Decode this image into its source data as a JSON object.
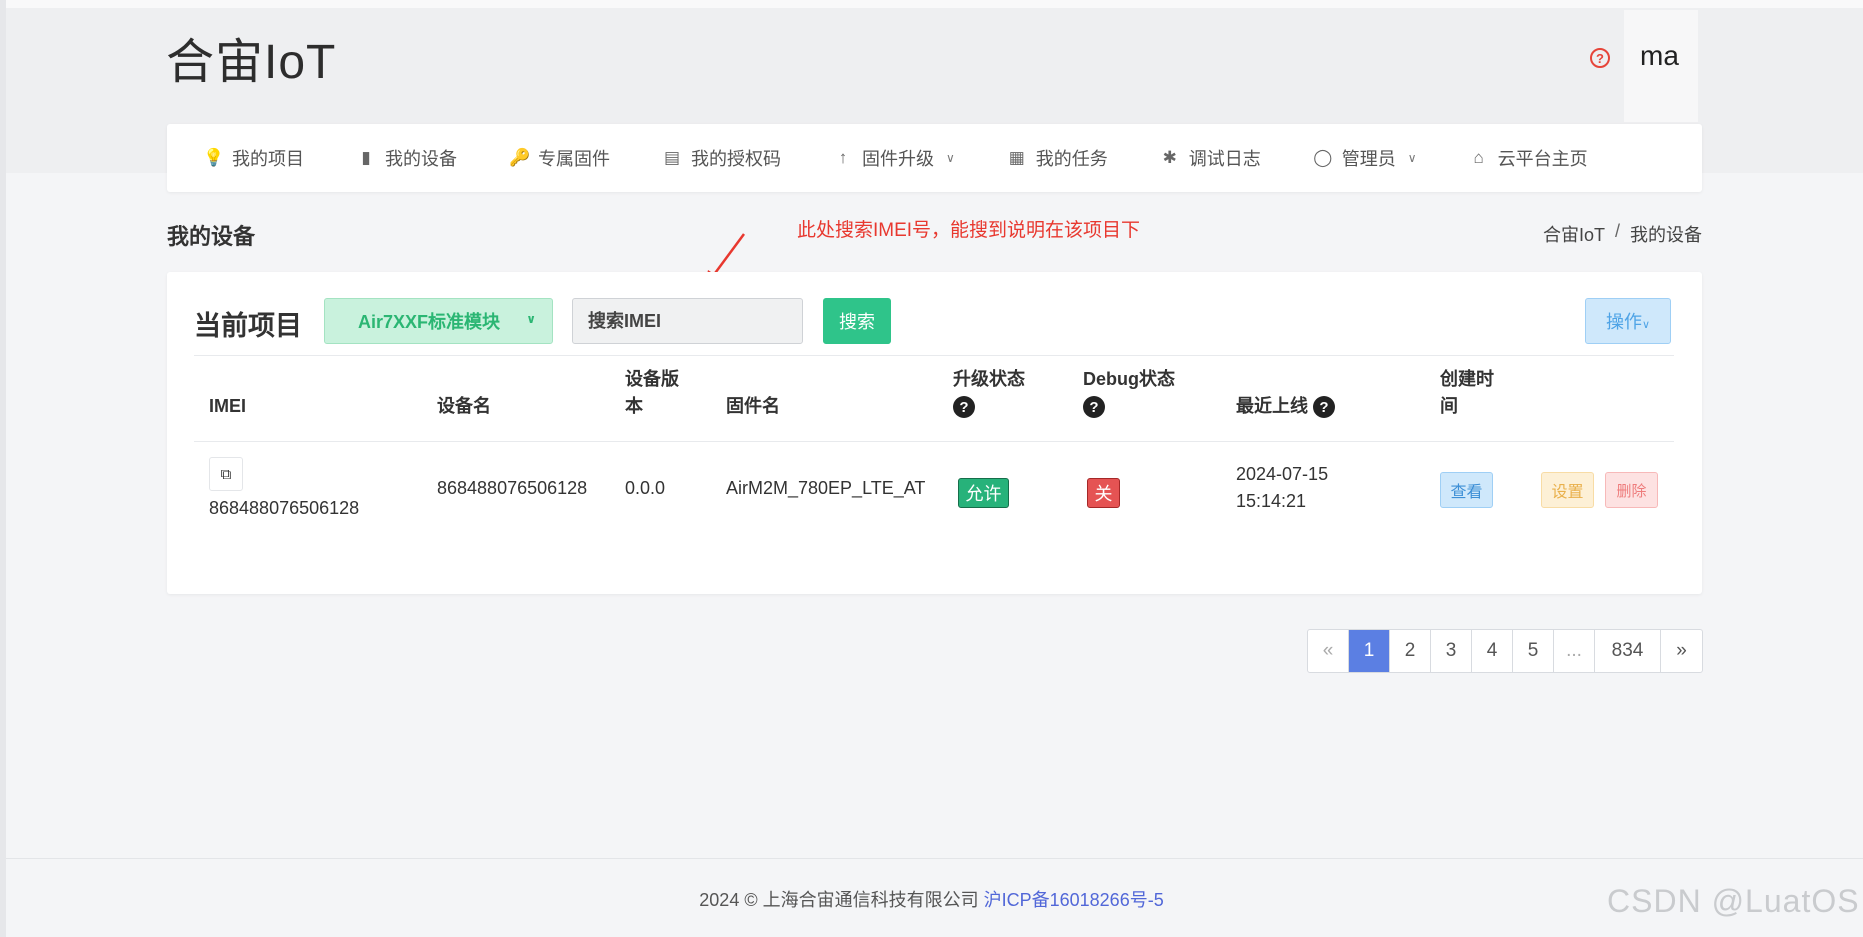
{
  "app": {
    "brand": "合宙IoT",
    "user": "ma"
  },
  "nav": [
    {
      "icon": "lightbulb-icon",
      "glyph": "💡",
      "label": "我的项目",
      "dropdown": false
    },
    {
      "icon": "chip-icon",
      "glyph": "▮",
      "label": "我的设备",
      "dropdown": false
    },
    {
      "icon": "key-icon",
      "glyph": "🔑",
      "label": "专属固件",
      "dropdown": false
    },
    {
      "icon": "id-card-icon",
      "glyph": "▤",
      "label": "我的授权码",
      "dropdown": false
    },
    {
      "icon": "arrow-up-icon",
      "glyph": "↑",
      "label": "固件升级",
      "dropdown": true
    },
    {
      "icon": "calendar-icon",
      "glyph": "▦",
      "label": "我的任务",
      "dropdown": false
    },
    {
      "icon": "bug-icon",
      "glyph": "✱",
      "label": "调试日志",
      "dropdown": false
    },
    {
      "icon": "user-icon",
      "glyph": "◯",
      "label": "管理员",
      "dropdown": true
    },
    {
      "icon": "home-icon",
      "glyph": "⌂",
      "label": "云平台主页",
      "dropdown": false
    }
  ],
  "page": {
    "title": "我的设备",
    "annotation": "此处搜索IMEI号，能搜到说明在该项目下",
    "breadcrumb": [
      "合宙IoT",
      "我的设备"
    ]
  },
  "toolbar": {
    "project_label": "当前项目",
    "project_selected": "Air7XXF标准模块",
    "search_placeholder": "搜索IMEI",
    "search_value": "",
    "search_button": "搜索",
    "ops_button": "操作"
  },
  "table": {
    "columns": {
      "imei": "IMEI",
      "name": "设备名",
      "version_l1": "设备版",
      "version_l2": "本",
      "firmware": "固件名",
      "upgrade": "升级状态",
      "debug": "Debug状态",
      "last_online": "最近上线",
      "created_l1": "创建时",
      "created_l2": "间"
    },
    "rows": [
      {
        "imei": "868488076506128",
        "name": "868488076506128",
        "version": "0.0.0",
        "firmware": "AirM2M_780EP_LTE_AT",
        "upgrade": "允许",
        "debug": "关",
        "last_online_date": "2024-07-15",
        "last_online_time": "15:14:21",
        "actions": {
          "view": "查看",
          "settings": "设置",
          "delete": "删除"
        }
      }
    ]
  },
  "pagination": {
    "prev": "«",
    "pages": [
      "1",
      "2",
      "3",
      "4",
      "5"
    ],
    "ellipsis": "...",
    "last": "834",
    "next": "»",
    "current": "1"
  },
  "footer": {
    "text": "2024 © 上海合宙通信科技有限公司",
    "icp": "沪ICP备16018266号-5"
  },
  "watermark": "CSDN @LuatOS",
  "colors": {
    "accent": "#2fc48a",
    "primary": "#5b7fe3",
    "danger": "#e55353",
    "annotation": "#e8382f"
  }
}
